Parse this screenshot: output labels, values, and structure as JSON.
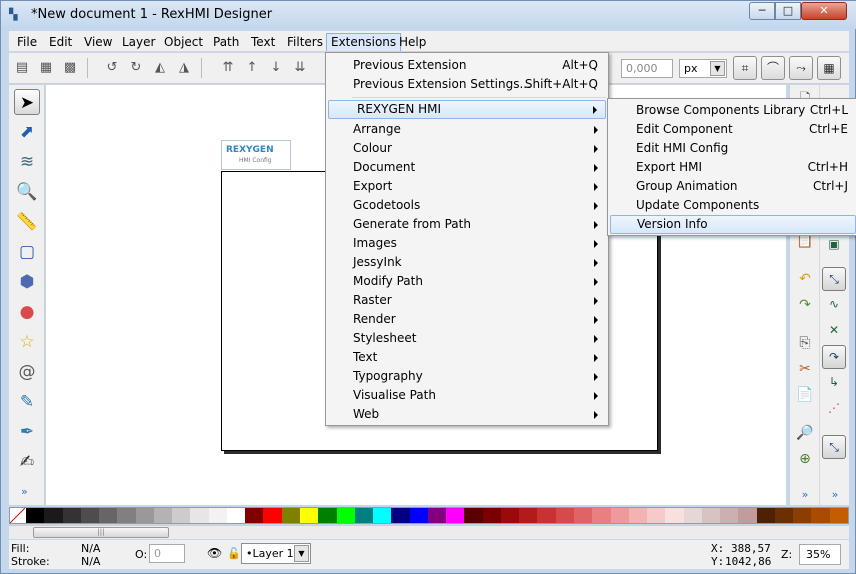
{
  "window": {
    "title": "*New document 1 - RexHMI Designer",
    "icon": "app-icon",
    "min_label": "─",
    "max_label": "□",
    "close_label": "✕"
  },
  "menubar": {
    "items": [
      {
        "label": "File"
      },
      {
        "label": "Edit"
      },
      {
        "label": "View"
      },
      {
        "label": "Layer"
      },
      {
        "label": "Object"
      },
      {
        "label": "Path"
      },
      {
        "label": "Text"
      },
      {
        "label": "Filters"
      },
      {
        "label": "Extensions"
      },
      {
        "label": "Help"
      }
    ]
  },
  "toolbar": {
    "unit_value": "0,000",
    "unit": "px"
  },
  "canvas": {
    "logo_brand": "REXYGEN",
    "logo_sub": "HMI Config"
  },
  "extensions_menu": {
    "items": [
      {
        "label": "Previous Extension",
        "shortcut": "Alt+Q"
      },
      {
        "label": "Previous Extension Settings...",
        "shortcut": "Shift+Alt+Q"
      },
      {
        "label": "REXYGEN HMI",
        "submenu": true
      },
      {
        "label": "Arrange",
        "submenu": true
      },
      {
        "label": "Colour",
        "submenu": true
      },
      {
        "label": "Document",
        "submenu": true
      },
      {
        "label": "Export",
        "submenu": true
      },
      {
        "label": "Gcodetools",
        "submenu": true
      },
      {
        "label": "Generate from Path",
        "submenu": true
      },
      {
        "label": "Images",
        "submenu": true
      },
      {
        "label": "JessyInk",
        "submenu": true
      },
      {
        "label": "Modify Path",
        "submenu": true
      },
      {
        "label": "Raster",
        "submenu": true
      },
      {
        "label": "Render",
        "submenu": true
      },
      {
        "label": "Stylesheet",
        "submenu": true
      },
      {
        "label": "Text",
        "submenu": true
      },
      {
        "label": "Typography",
        "submenu": true
      },
      {
        "label": "Visualise Path",
        "submenu": true
      },
      {
        "label": "Web",
        "submenu": true
      }
    ]
  },
  "hmi_submenu": {
    "items": [
      {
        "label": "Browse Components Library",
        "shortcut": "Ctrl+L"
      },
      {
        "label": "Edit Component",
        "shortcut": "Ctrl+E"
      },
      {
        "label": "Edit HMI Config",
        "shortcut": ""
      },
      {
        "label": "Export HMI",
        "shortcut": "Ctrl+H"
      },
      {
        "label": "Group Animation",
        "shortcut": "Ctrl+J"
      },
      {
        "label": "Update Components",
        "shortcut": ""
      },
      {
        "label": "Version Info",
        "shortcut": ""
      }
    ]
  },
  "statusbar": {
    "fill_label": "Fill:",
    "fill_value": "N/A",
    "stroke_label": "Stroke:",
    "stroke_value": "N/A",
    "opacity_label": "O:",
    "opacity_value": "0",
    "layer": "•Layer 1",
    "x_label": "X:",
    "x_value": "388,57",
    "y_label": "Y:",
    "y_value": "1042,86",
    "zoom_label": "Z:",
    "zoom_value": "35%"
  },
  "palette": [
    "#000000",
    "#1a1a1a",
    "#333333",
    "#4d4d4d",
    "#666666",
    "#808080",
    "#999999",
    "#b3b3b3",
    "#cccccc",
    "#e6e6e6",
    "#f2f2f2",
    "#ffffff",
    "#800000",
    "#ff0000",
    "#808000",
    "#ffff00",
    "#008000",
    "#00ff00",
    "#008080",
    "#00ffff",
    "#000080",
    "#0000ff",
    "#800080",
    "#ff00ff",
    "#5a0000",
    "#7a0000",
    "#9a0a0a",
    "#b31b1b",
    "#c83232",
    "#d64a4a",
    "#e06464",
    "#e88080",
    "#ee9a9a",
    "#f3b3b3",
    "#f7caca",
    "#fadfdf",
    "#e6d6d6",
    "#d9c2c2",
    "#ccb0b0",
    "#c09c9c",
    "#4d2200",
    "#6b3000",
    "#8a3f00",
    "#a84d00",
    "#c45c00"
  ]
}
